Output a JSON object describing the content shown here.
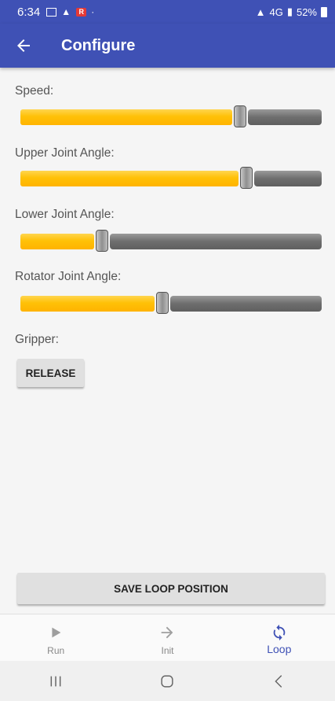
{
  "status_bar": {
    "time": "6:34",
    "network": "4G",
    "battery": "52%"
  },
  "app_bar": {
    "title": "Configure",
    "back_icon": "arrow-left-icon"
  },
  "controls": {
    "speed": {
      "label": "Speed:",
      "value": 0.74
    },
    "upper_joint": {
      "label": "Upper Joint Angle:",
      "value": 0.76
    },
    "lower_joint": {
      "label": "Lower Joint Angle:",
      "value": 0.26
    },
    "rotator_joint": {
      "label": "Rotator Joint Angle:",
      "value": 0.47
    },
    "gripper": {
      "label": "Gripper:",
      "button_label": "RELEASE"
    }
  },
  "save_button_label": "SAVE LOOP POSITION",
  "bottom_nav": {
    "items": [
      {
        "label": "Run",
        "icon": "play-icon",
        "active": false
      },
      {
        "label": "Init",
        "icon": "arrow-right-icon",
        "active": false
      },
      {
        "label": "Loop",
        "icon": "loop-icon",
        "active": true
      }
    ]
  },
  "colors": {
    "primary": "#3f51b5",
    "slider_fill": "#ffc107",
    "slider_track": "#6e6e6e",
    "background": "#f5f5f5"
  }
}
